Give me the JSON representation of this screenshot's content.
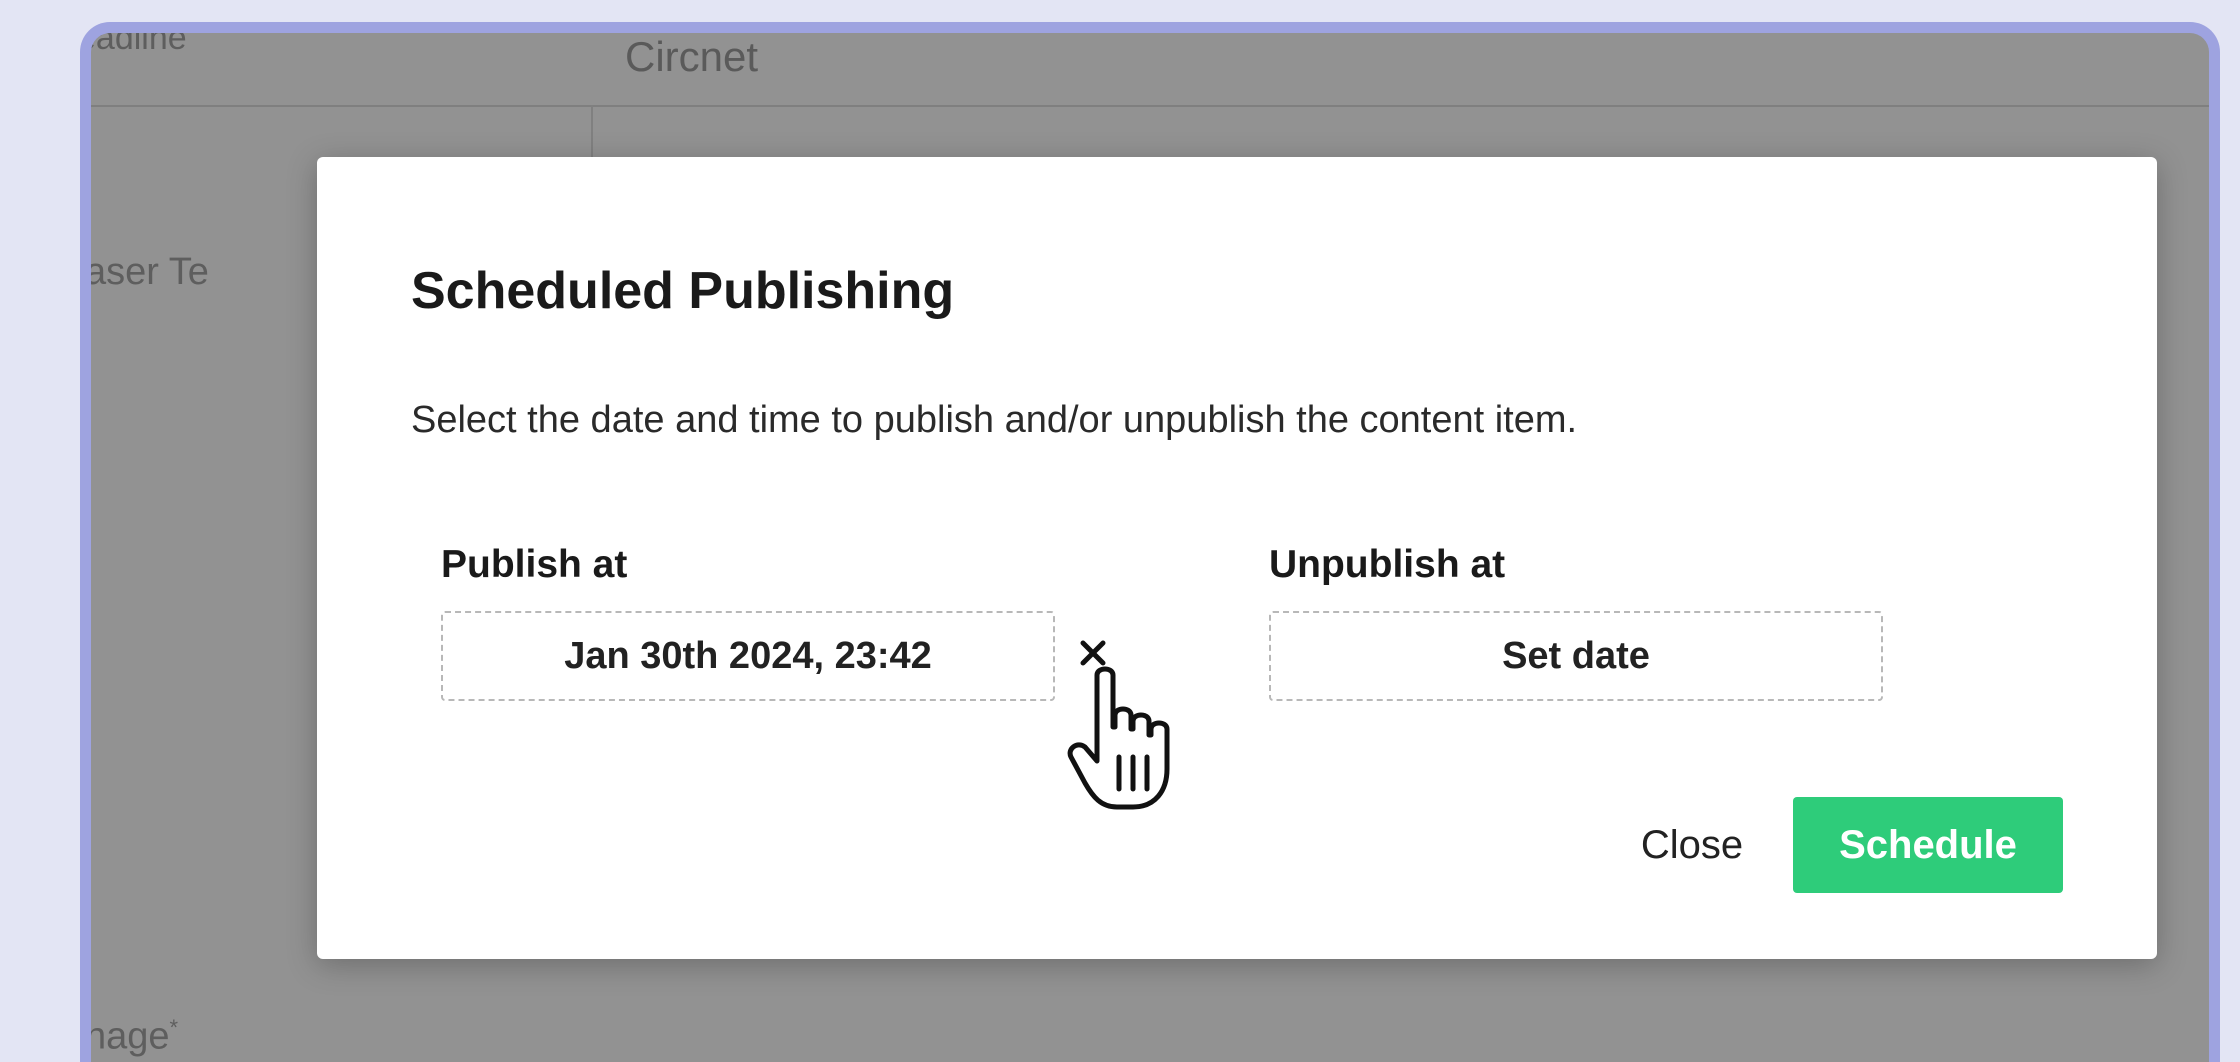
{
  "background": {
    "top_left_label": "eadline",
    "top_value": "Circnet",
    "teaser_label": "aser Te",
    "image_label": "nage",
    "image_required_mark": "*"
  },
  "modal": {
    "title": "Scheduled Publishing",
    "description": "Select the date and time to publish and/or unpublish the content item.",
    "publish": {
      "label": "Publish at",
      "value": "Jan 30th 2024, 23:42",
      "clear_icon": "close-icon"
    },
    "unpublish": {
      "label": "Unpublish at",
      "value": "Set date"
    },
    "buttons": {
      "close_label": "Close",
      "schedule_label": "Schedule"
    }
  },
  "colors": {
    "accent": "#2ecc7a",
    "frame_border": "#9ea3e0",
    "page_background": "#e3e5f4",
    "overlay": "#929292"
  }
}
